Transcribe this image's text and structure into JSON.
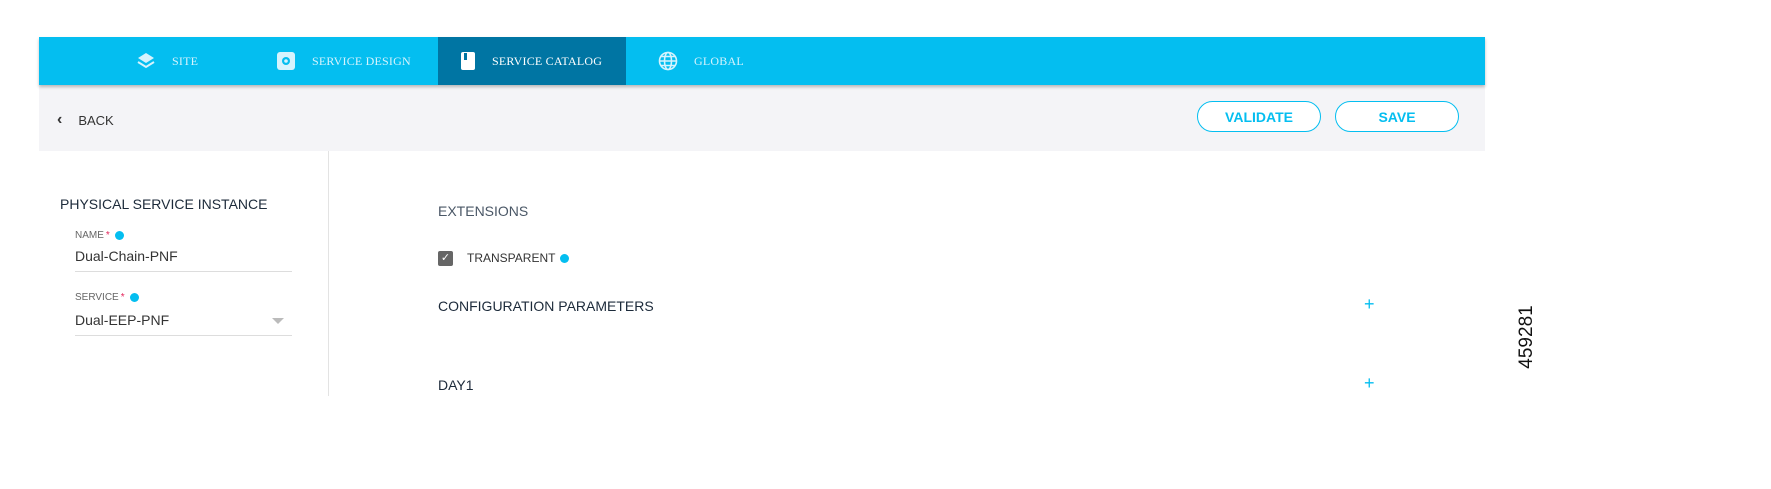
{
  "nav": {
    "tabs": [
      {
        "label": "SITE",
        "icon": "layers-icon"
      },
      {
        "label": "SERVICE DESIGN",
        "icon": "gear-icon"
      },
      {
        "label": "SERVICE CATALOG",
        "icon": "book-icon",
        "active": true
      },
      {
        "label": "GLOBAL",
        "icon": "globe-icon"
      }
    ]
  },
  "toolbar": {
    "back_label": "BACK",
    "validate_label": "VALIDATE",
    "save_label": "SAVE"
  },
  "left": {
    "title": "PHYSICAL SERVICE INSTANCE",
    "name_label": "NAME",
    "name_value": "Dual-Chain-PNF",
    "service_label": "SERVICE",
    "service_value": "Dual-EEP-PNF",
    "required_mark": "*"
  },
  "main": {
    "extensions_title": "EXTENSIONS",
    "transparent_label": "TRANSPARENT",
    "transparent_checked": true,
    "config_title": "CONFIGURATION PARAMETERS",
    "day1_title": "DAY1",
    "expand_symbol": "+"
  },
  "figure_id": "459281",
  "colors": {
    "accent": "#04bef0",
    "active_tab": "#0075a3"
  }
}
